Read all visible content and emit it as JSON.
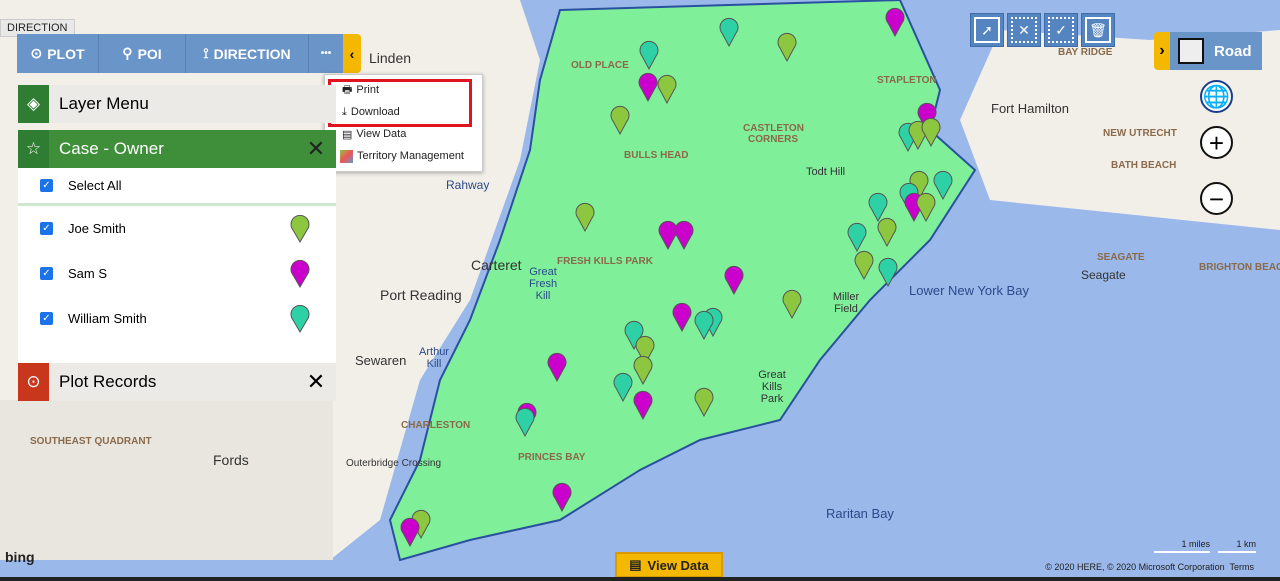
{
  "tooltip": "DIRECTION",
  "toolbar": {
    "plot": "PLOT",
    "poi": "POI",
    "direction": "DIRECTION",
    "more": "•••",
    "collapse": "‹"
  },
  "more_menu": {
    "items": [
      {
        "label": "Print",
        "icon": "printer-icon"
      },
      {
        "label": "Download",
        "icon": "download-icon"
      },
      {
        "label": "View Data",
        "icon": "table-icon"
      },
      {
        "label": "Territory Management",
        "icon": "territory-icon"
      }
    ],
    "highlight_color": "#e0141e"
  },
  "layer_menu": {
    "title": "Layer Menu"
  },
  "case_owner": {
    "title": "Case - Owner",
    "select_all": "Select All",
    "owners": [
      {
        "name": "Joe Smith",
        "color": "#8dc63f"
      },
      {
        "name": "Sam S",
        "color": "#cc00cc"
      },
      {
        "name": "William Smith",
        "color": "#2ed1a6"
      }
    ]
  },
  "plot_records": {
    "title": "Plot Records"
  },
  "map_type": {
    "label": "Road"
  },
  "view_data": "View Data",
  "scale": {
    "miles": "1 miles",
    "km": "1 km"
  },
  "copyright": "© 2020 HERE, © 2020 Microsoft Corporation",
  "terms": "Terms",
  "bing": "bing",
  "colors": {
    "toolbar": "#6a95c8",
    "accent": "#f5b800",
    "territory": "#7fef9a",
    "layer_green": "#3f8f3a",
    "plot_red": "#c8361c"
  },
  "map_labels": [
    "Linden",
    "OLD PLACE",
    "STAPLETON",
    "BAY RIDGE",
    "Fort Hamilton",
    "NEW UTRECHT",
    "CASTLETON CORNERS",
    "BULLS HEAD",
    "Todt Hill",
    "BATH BEACH",
    "Rahway",
    "Carteret",
    "FRESH KILLS PARK",
    "Great Fresh Kill",
    "Port Reading",
    "Miller Field",
    "Lower New York Bay",
    "Seagate",
    "SEAGATE",
    "BRIGHTON BEACH",
    "Sewaren",
    "Arthur Kill",
    "Great Kills Park",
    "CHARLESTON",
    "SOUTHEAST QUADRANT",
    "Fords",
    "Outerbridge Crossing",
    "PRINCES BAY",
    "Raritan Bay"
  ]
}
